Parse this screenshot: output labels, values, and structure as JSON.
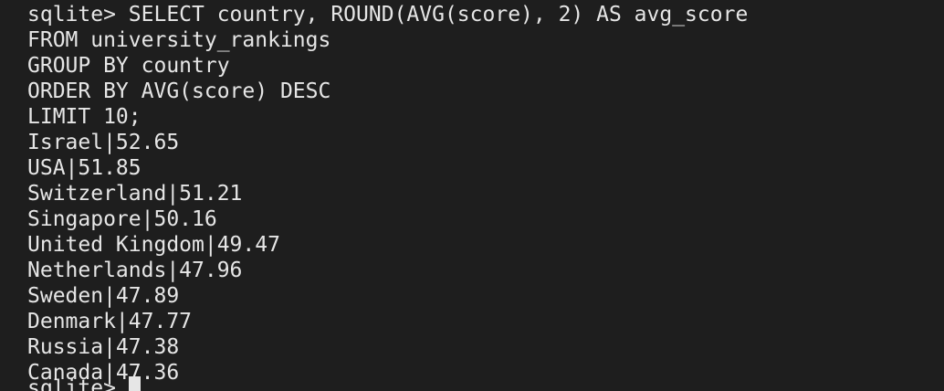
{
  "terminal": {
    "prompt": "sqlite> ",
    "query_lines": [
      "sqlite> SELECT country, ROUND(AVG(score), 2) AS avg_score",
      "FROM university_rankings",
      "GROUP BY country",
      "ORDER BY AVG(score) DESC",
      "LIMIT 10;"
    ],
    "results": [
      "Israel|52.65",
      "USA|51.85",
      "Switzerland|51.21",
      "Singapore|50.16",
      "United Kingdom|49.47",
      "Netherlands|47.96",
      "Sweden|47.89",
      "Denmark|47.77",
      "Russia|47.38",
      "Canada|47.36"
    ],
    "next_prompt": "sqlite> "
  },
  "colors": {
    "background": "#1e1e1e",
    "text": "#e6e6e6"
  }
}
